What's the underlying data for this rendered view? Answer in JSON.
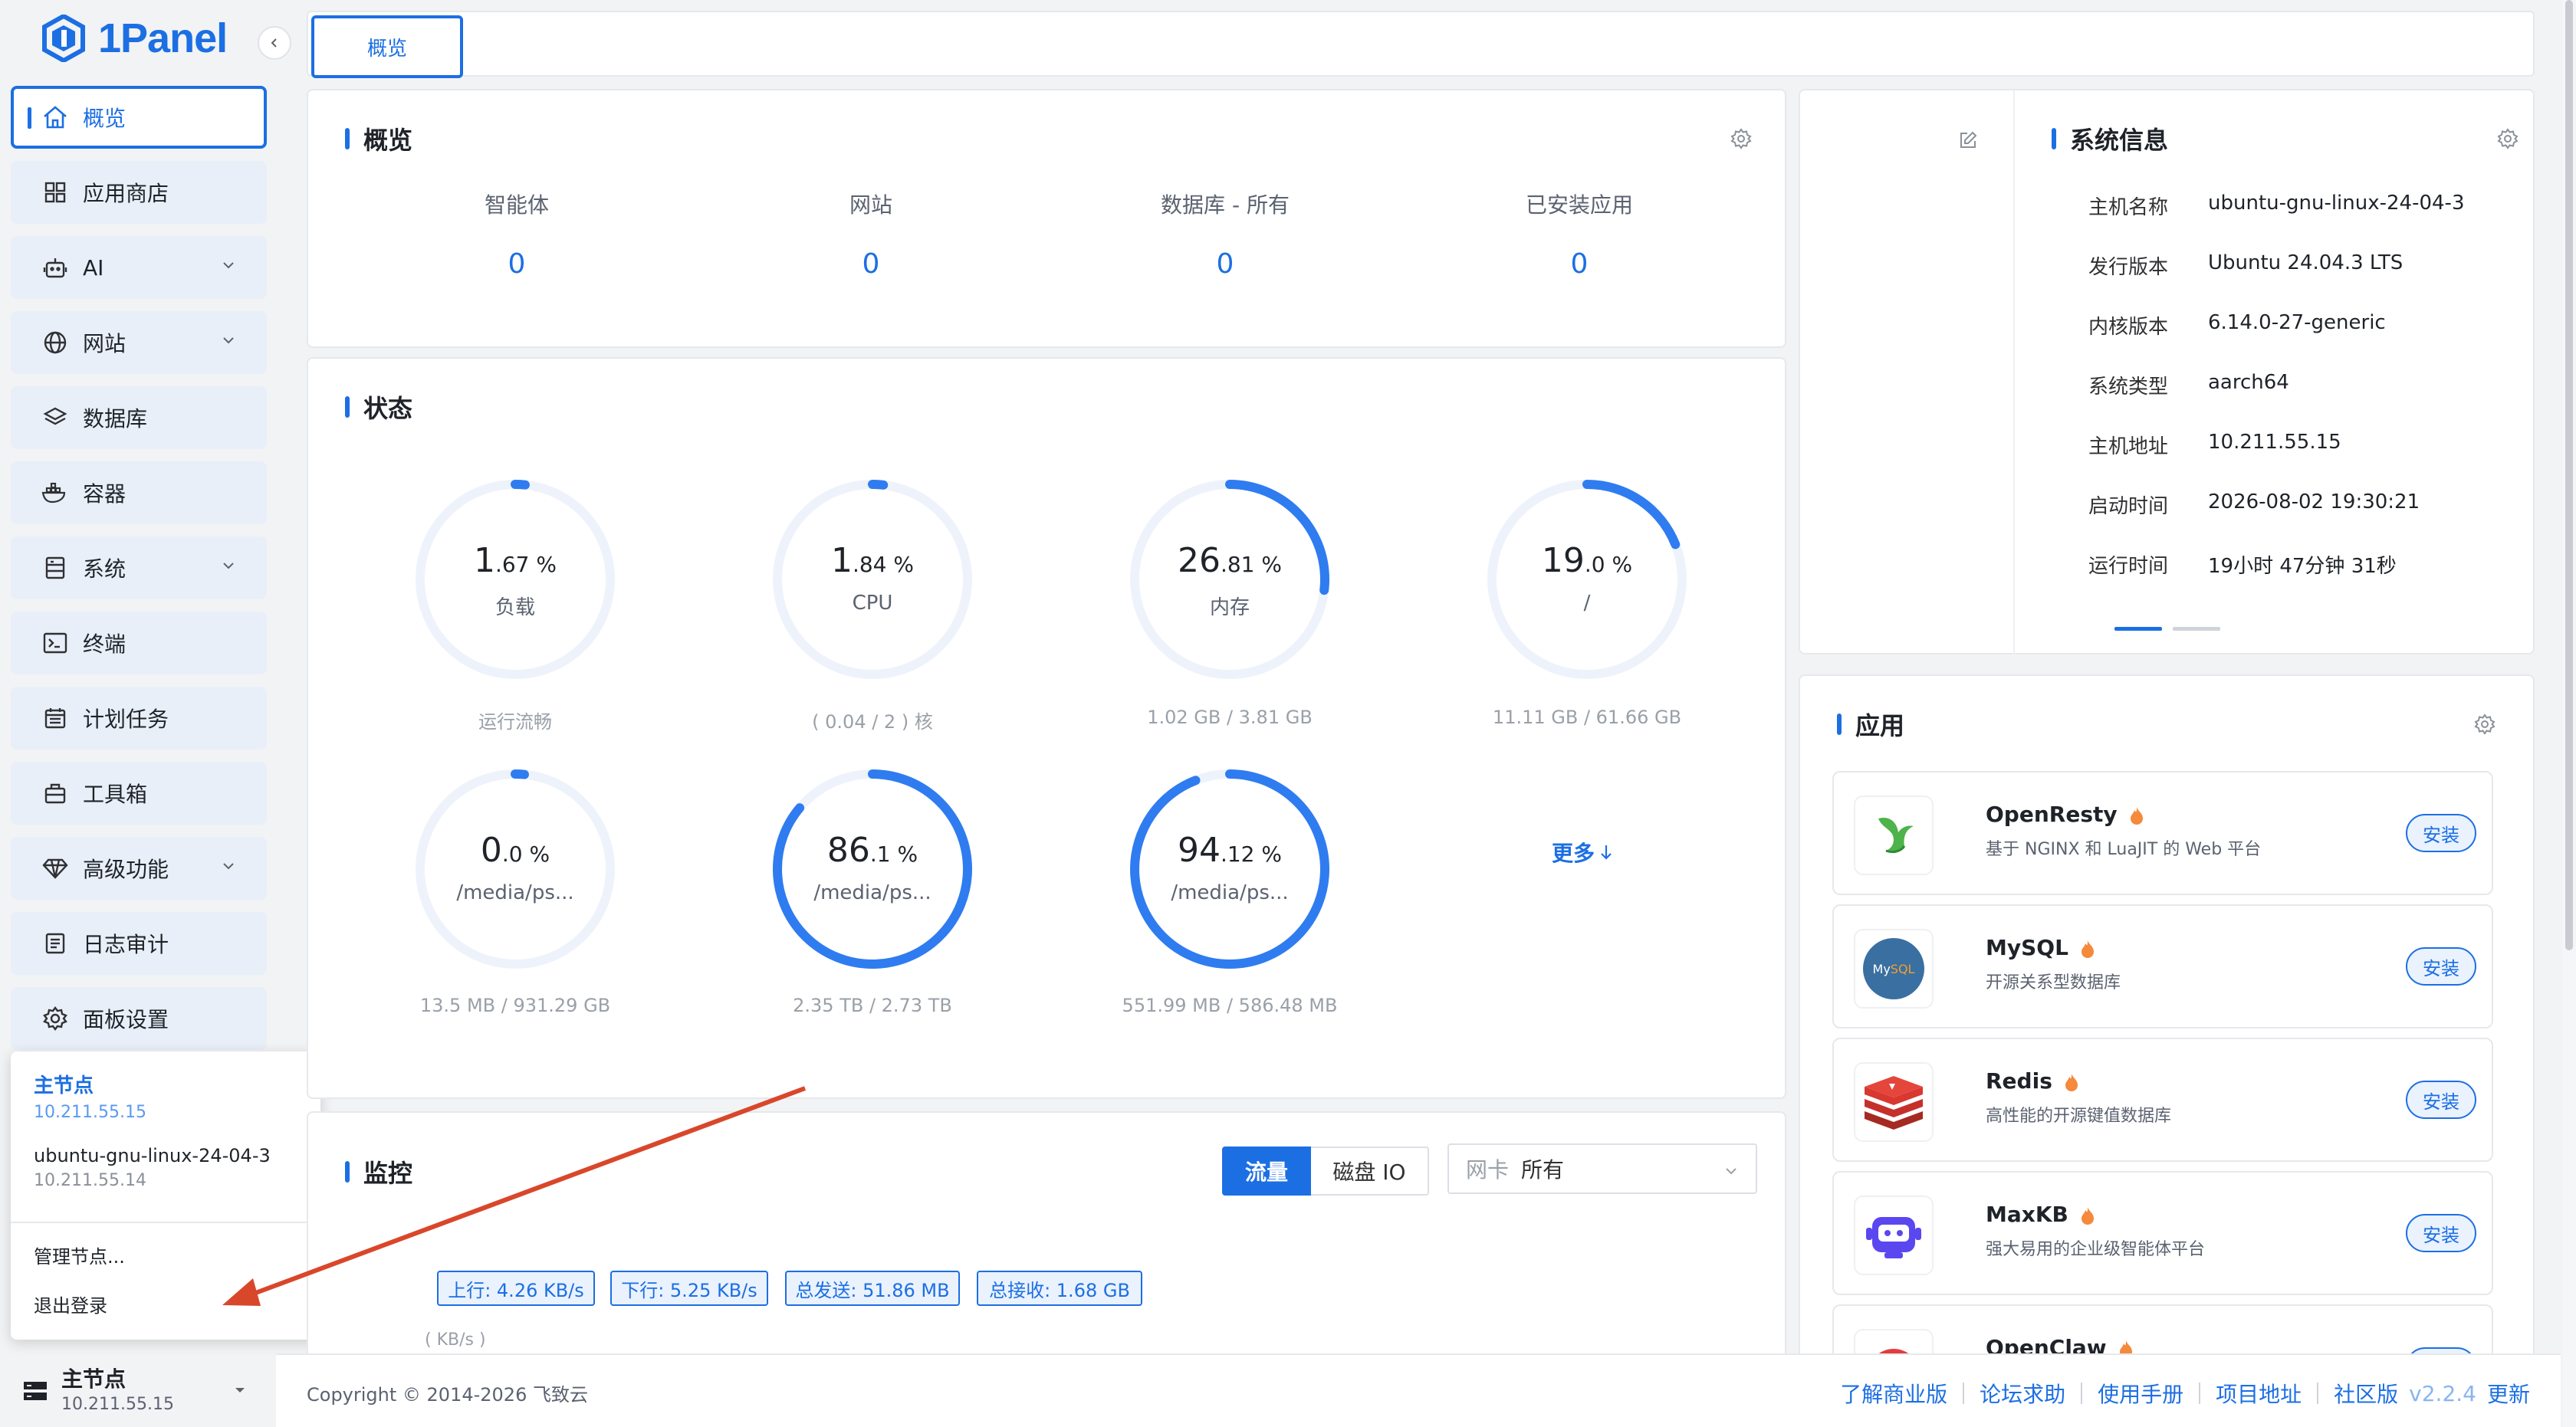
{
  "app": {
    "name": "1Panel"
  },
  "sidebar": {
    "items": [
      {
        "label": "概览",
        "icon": "home-icon"
      },
      {
        "label": "应用商店",
        "icon": "grid-icon"
      },
      {
        "label": "AI",
        "icon": "robot-icon"
      },
      {
        "label": "网站",
        "icon": "globe-icon"
      },
      {
        "label": "数据库",
        "icon": "layers-icon"
      },
      {
        "label": "容器",
        "icon": "docker-icon"
      },
      {
        "label": "系统",
        "icon": "server-icon"
      },
      {
        "label": "终端",
        "icon": "terminal-icon"
      },
      {
        "label": "计划任务",
        "icon": "calendar-icon"
      },
      {
        "label": "工具箱",
        "icon": "toolbox-icon"
      },
      {
        "label": "高级功能",
        "icon": "diamond-icon"
      },
      {
        "label": "日志审计",
        "icon": "log-icon"
      },
      {
        "label": "面板设置",
        "icon": "gear-icon"
      }
    ]
  },
  "node_menu": {
    "nodes": [
      {
        "name": "主节点",
        "ip": "10.211.55.15"
      },
      {
        "name": "ubuntu-gnu-linux-24-04-3",
        "ip": "10.211.55.14"
      }
    ],
    "manage": "管理节点...",
    "logout": "退出登录"
  },
  "current_node": {
    "name": "主节点",
    "ip": "10.211.55.15"
  },
  "tabs": [
    {
      "label": "概览"
    }
  ],
  "overview": {
    "title": "概览",
    "items": [
      {
        "label": "智能体",
        "value": "0"
      },
      {
        "label": "网站",
        "value": "0"
      },
      {
        "label": "数据库 - 所有",
        "value": "0"
      },
      {
        "label": "已安装应用",
        "value": "0"
      }
    ]
  },
  "status": {
    "title": "状态",
    "gauges": [
      {
        "int": "1",
        "dec": ".67 %",
        "label": "负载",
        "caption": "运行流畅",
        "percent": 1.67
      },
      {
        "int": "1",
        "dec": ".84 %",
        "label": "CPU",
        "caption": "( 0.04 / 2 ) 核",
        "percent": 1.84
      },
      {
        "int": "26",
        "dec": ".81 %",
        "label": "内存",
        "caption": "1.02 GB / 3.81 GB",
        "percent": 26.81
      },
      {
        "int": "19",
        "dec": ".0 %",
        "label": "/",
        "caption": "11.11 GB / 61.66 GB",
        "percent": 19.0
      },
      {
        "int": "0",
        "dec": ".0 %",
        "label": "/media/ps...",
        "caption": "13.5 MB / 931.29 GB",
        "percent": 0.0
      },
      {
        "int": "86",
        "dec": ".1 %",
        "label": "/media/ps...",
        "caption": "2.35 TB / 2.73 TB",
        "percent": 86.1
      },
      {
        "int": "94",
        "dec": ".12 %",
        "label": "/media/ps...",
        "caption": "551.99 MB / 586.48 MB",
        "percent": 94.12
      }
    ],
    "more": "更多"
  },
  "monitor": {
    "title": "监控",
    "tab_traffic": "流量",
    "tab_disk": "磁盘 IO",
    "nic_label": "网卡",
    "nic_value": "所有",
    "tags": [
      "上行: 4.26 KB/s",
      "下行: 5.25 KB/s",
      "总发送: 51.86 MB",
      "总接收: 1.68 GB"
    ],
    "unit": "( KB/s )"
  },
  "sysinfo": {
    "title": "系统信息",
    "rows": [
      {
        "k": "主机名称",
        "v": "ubuntu-gnu-linux-24-04-3"
      },
      {
        "k": "发行版本",
        "v": "Ubuntu 24.04.3 LTS"
      },
      {
        "k": "内核版本",
        "v": "6.14.0-27-generic"
      },
      {
        "k": "系统类型",
        "v": "aarch64"
      },
      {
        "k": "主机地址",
        "v": "10.211.55.15"
      },
      {
        "k": "启动时间",
        "v": "2026-08-02 19:30:21"
      },
      {
        "k": "运行时间",
        "v": "19小时 47分钟 31秒"
      }
    ]
  },
  "apps": {
    "title": "应用",
    "install": "安装",
    "items": [
      {
        "name": "OpenResty",
        "desc": "基于 NGINX 和 LuaJIT 的 Web 平台"
      },
      {
        "name": "MySQL",
        "desc": "开源关系型数据库"
      },
      {
        "name": "Redis",
        "desc": "高性能的开源键值数据库"
      },
      {
        "name": "MaxKB",
        "desc": "强大易用的企业级智能体平台"
      },
      {
        "name": "OpenClaw",
        "desc": ""
      }
    ]
  },
  "footer": {
    "copyright": "Copyright © 2014-2026 飞致云",
    "links": [
      "了解商业版",
      "论坛求助",
      "使用手册",
      "项目地址",
      "社区版"
    ],
    "version": "v2.2.4",
    "update": "更新"
  },
  "colors": {
    "accent": "#1c6fe3",
    "annotation_arrow": "#d9472b"
  }
}
